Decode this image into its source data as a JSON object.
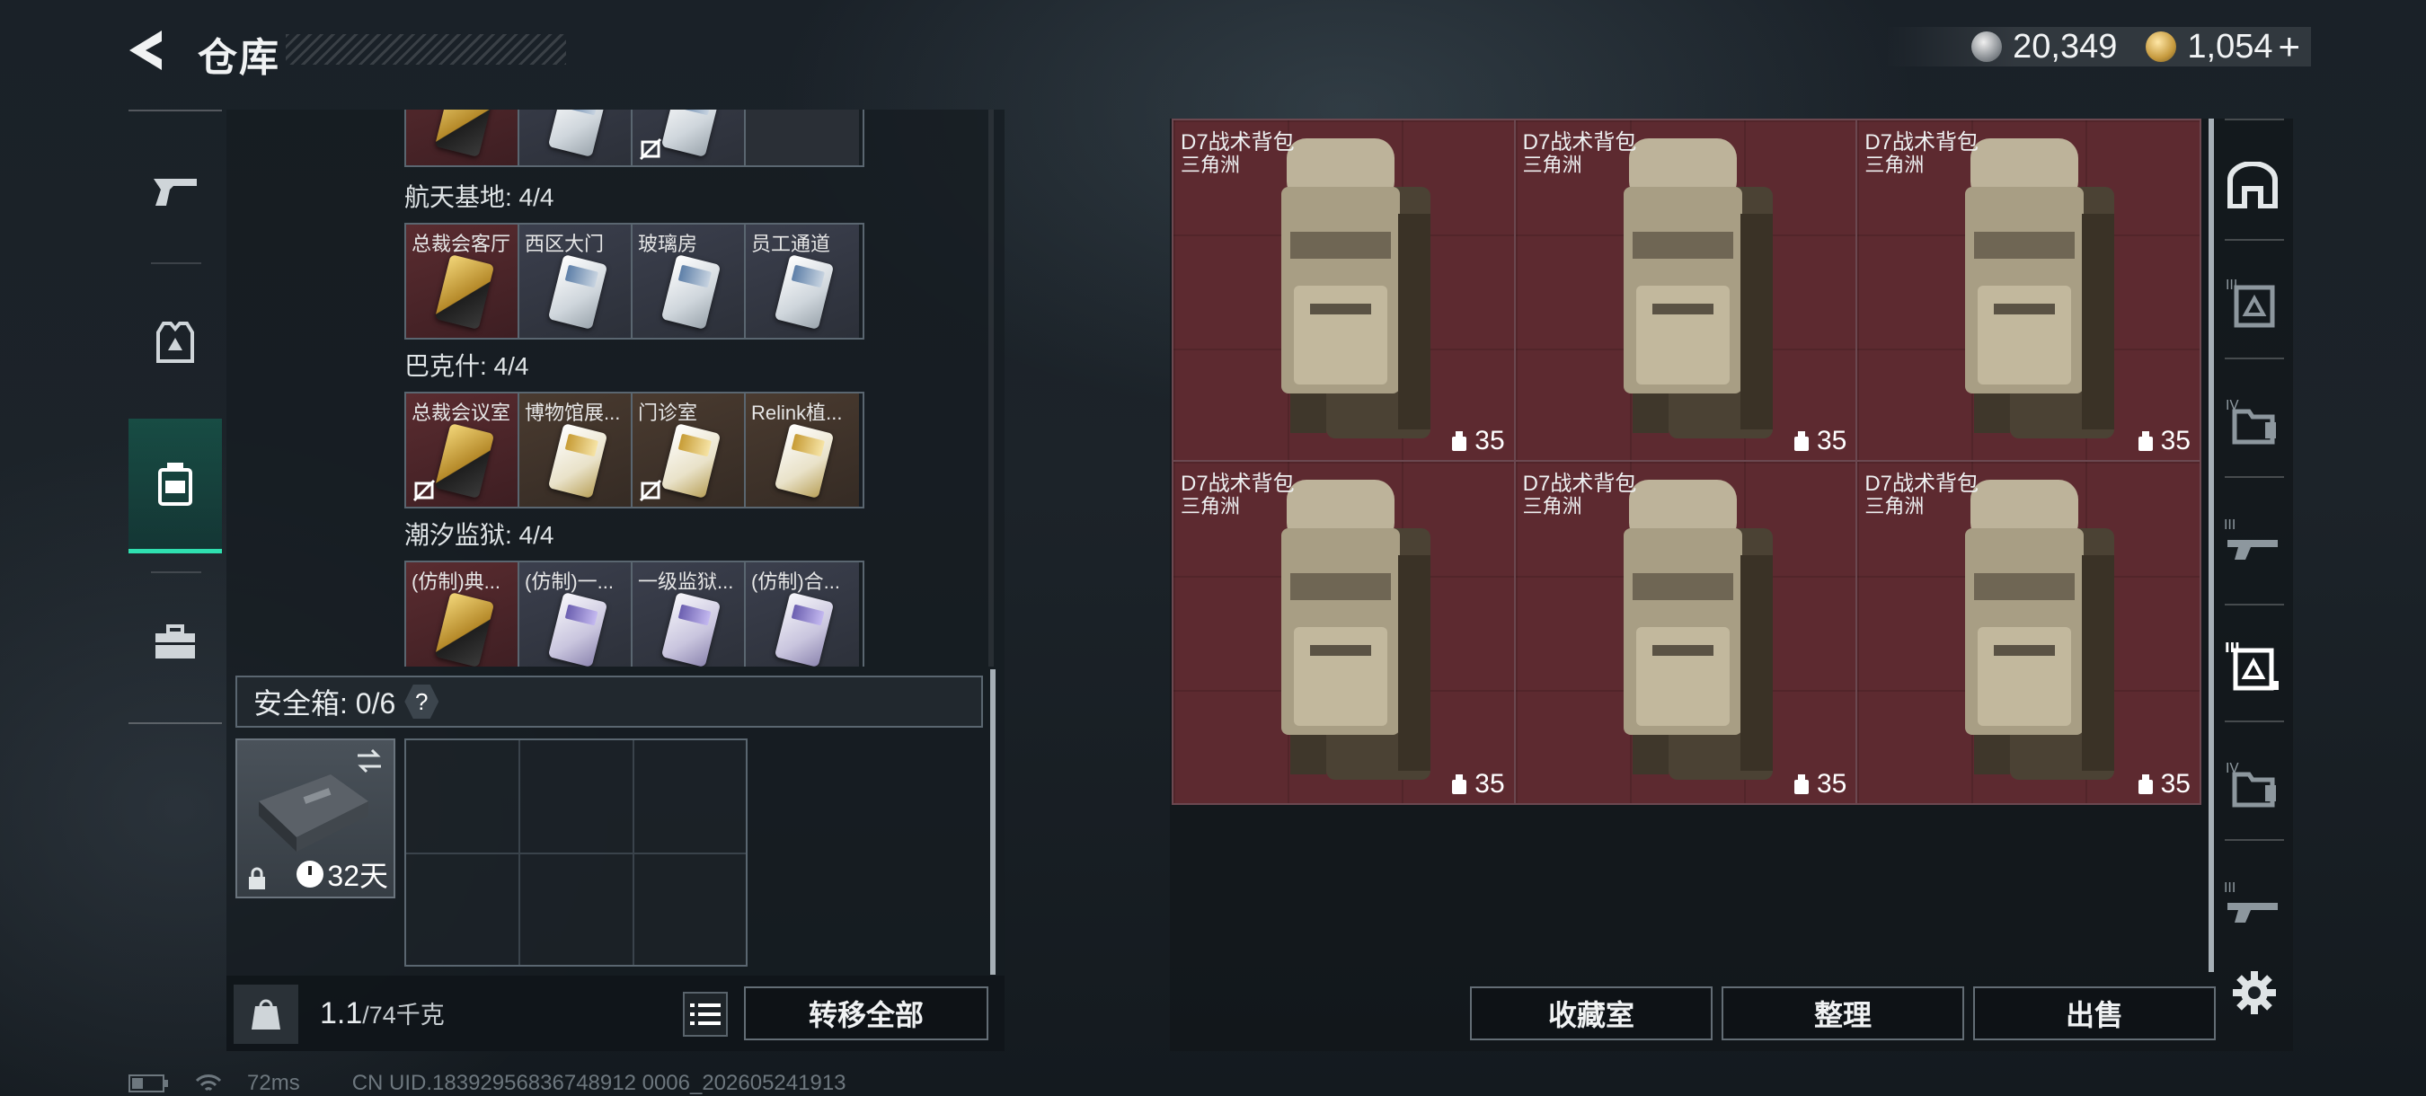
{
  "header": {
    "title": "仓库",
    "currencies": [
      {
        "icon": "silver-coin-icon",
        "value": "20,349"
      },
      {
        "icon": "gold-coin-icon",
        "value": "1,054"
      }
    ],
    "add_currency": "+"
  },
  "left_nav": [
    {
      "icon": "pistol-icon"
    },
    {
      "icon": "armor-vest-icon"
    },
    {
      "icon": "backpack-icon",
      "active": true
    },
    {
      "icon": "briefcase-icon"
    }
  ],
  "key_groups": [
    {
      "label": "",
      "cards": [
        {
          "name": "",
          "style": "red",
          "card": "gold"
        },
        {
          "name": "",
          "style": "grey",
          "card": "white"
        },
        {
          "name": "",
          "style": "grey",
          "card": "white",
          "no_trade": true
        },
        {
          "name": "",
          "style": "dark",
          "card": ""
        }
      ]
    },
    {
      "label": "航天基地: 4/4",
      "cards": [
        {
          "name": "总裁会客厅",
          "style": "red",
          "card": "gold"
        },
        {
          "name": "西区大门",
          "style": "grey",
          "card": "white"
        },
        {
          "name": "玻璃房",
          "style": "grey",
          "card": "white"
        },
        {
          "name": "员工通道",
          "style": "grey",
          "card": "white"
        }
      ]
    },
    {
      "label": "巴克什: 4/4",
      "cards": [
        {
          "name": "总裁会议室",
          "style": "red",
          "card": "gold",
          "no_trade": true
        },
        {
          "name": "博物馆展...",
          "style": "brown",
          "card": "goldwhite"
        },
        {
          "name": "门诊室",
          "style": "brown",
          "card": "goldwhite",
          "no_trade": true
        },
        {
          "name": "Relink植...",
          "style": "brown",
          "card": "goldwhite"
        }
      ]
    },
    {
      "label": "潮汐监狱: 4/4",
      "cards": [
        {
          "name": "(仿制)典...",
          "style": "red",
          "card": "gold"
        },
        {
          "name": "(仿制)一...",
          "style": "grey",
          "card": "purple"
        },
        {
          "name": "一级监狱...",
          "style": "grey",
          "card": "purple"
        },
        {
          "name": "(仿制)合...",
          "style": "grey",
          "card": "purple"
        }
      ]
    }
  ],
  "safe_box": {
    "label": "安全箱: 0/6",
    "help": "?",
    "duration": "32天"
  },
  "weight": {
    "current": "1.1",
    "max": "/74千克"
  },
  "buttons": {
    "transfer_all": "转移全部",
    "collection": "收藏室",
    "organize": "整理",
    "sell": "出售"
  },
  "backpacks": [
    {
      "name": "D7战术背包",
      "map": "三角洲",
      "count": "35"
    },
    {
      "name": "D7战术背包",
      "map": "三角洲",
      "count": "35"
    },
    {
      "name": "D7战术背包",
      "map": "三角洲",
      "count": "35"
    },
    {
      "name": "D7战术背包",
      "map": "三角洲",
      "count": "35"
    },
    {
      "name": "D7战术背包",
      "map": "三角洲",
      "count": "35"
    },
    {
      "name": "D7战术背包",
      "map": "三角洲",
      "count": "35"
    }
  ],
  "side_tabs": [
    {
      "icon": "all-items-icon",
      "level": ""
    },
    {
      "icon": "armor-tier-3-icon",
      "level": "III"
    },
    {
      "icon": "backpack-tier-4-icon",
      "level": "IV"
    },
    {
      "icon": "rig-tier-3-icon",
      "level": "III"
    },
    {
      "icon": "armor-tier-3-selected-icon",
      "level": "III"
    },
    {
      "icon": "backpack-tier-4-alt-icon",
      "level": "IV"
    },
    {
      "icon": "rig-tier-3-alt-icon",
      "level": "III"
    }
  ],
  "status": {
    "ping": "72ms",
    "uid": "CN UID.18392956836748912 0006_202605241913"
  }
}
